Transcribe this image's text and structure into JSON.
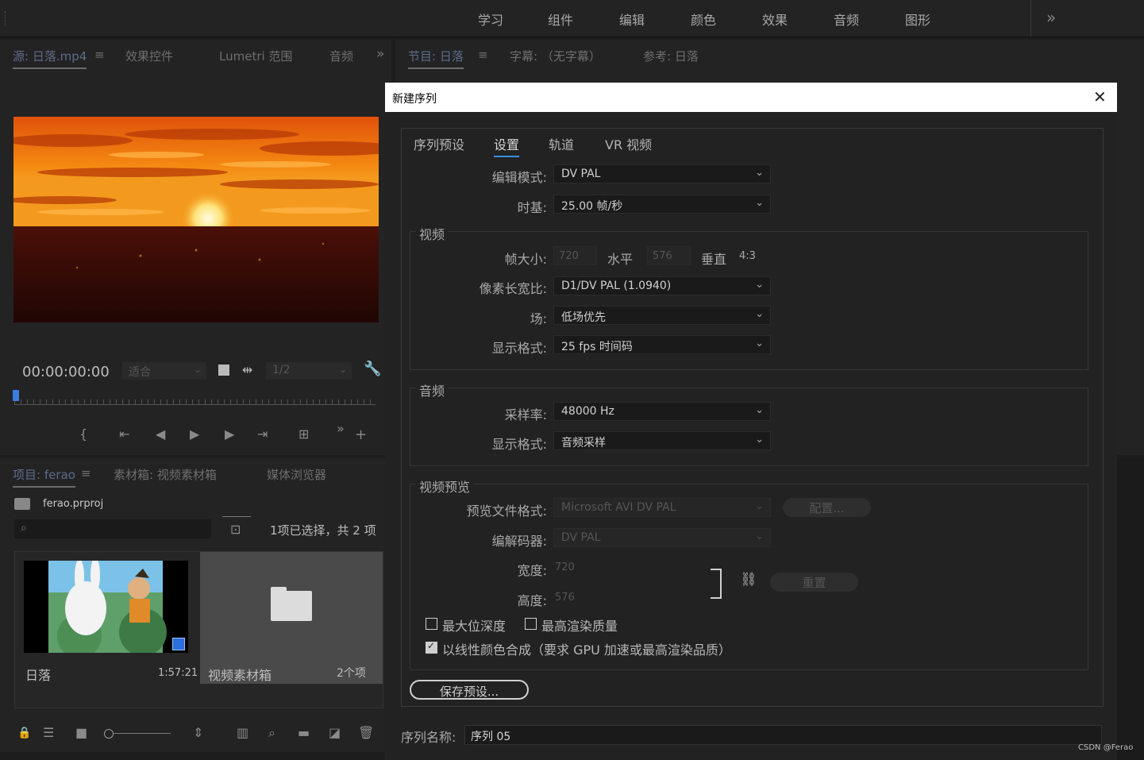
{
  "workspace_tabs": [
    "学习",
    "组件",
    "编辑",
    "颜色",
    "效果",
    "音频",
    "图形"
  ],
  "more_glyph": "»",
  "source_panel": {
    "tabs": [
      "源: 日落.mp4",
      "效果控件",
      "Lumetri 范围",
      "音频"
    ],
    "menu_glyph": "≡",
    "timecode": "00:00:00:00",
    "fit_label": "适合",
    "resolution": "1/2"
  },
  "program_panel": {
    "tabs": [
      "节目: 日落",
      "字幕: （无字幕）",
      "参考: 日落"
    ]
  },
  "project_panel": {
    "tabs": [
      "项目: ferao",
      "素材箱: 视频素材箱",
      "媒体浏览器"
    ],
    "file_name": "ferao.prproj",
    "selection_status": "1项已选择，共 2 项",
    "items": [
      {
        "name": "日落",
        "meta": "1:57:21"
      },
      {
        "name": "视频素材箱",
        "meta": "2个项"
      }
    ]
  },
  "dialog": {
    "title": "新建序列",
    "close_glyph": "✕",
    "tabs": [
      "序列预设",
      "设置",
      "轨道",
      "VR 视频"
    ],
    "active_tab": 1,
    "edit_mode": {
      "label": "编辑模式:",
      "value": "DV PAL"
    },
    "timebase": {
      "label": "时基:",
      "value": "25.00  帧/秒"
    },
    "video": {
      "title": "视频",
      "frame_size_label": "帧大小:",
      "width": "720",
      "horizontal_label": "水平",
      "height": "576",
      "vertical_label": "垂直",
      "aspect": "4:3",
      "pixel_aspect": {
        "label": "像素长宽比:",
        "value": "D1/DV PAL (1.0940)"
      },
      "fields": {
        "label": "场:",
        "value": "低场优先"
      },
      "display_format": {
        "label": "显示格式:",
        "value": "25 fps 时间码"
      }
    },
    "audio": {
      "title": "音频",
      "sample_rate": {
        "label": "采样率:",
        "value": "48000 Hz"
      },
      "display_format": {
        "label": "显示格式:",
        "value": "音频采样"
      }
    },
    "preview": {
      "title": "视频预览",
      "file_format": {
        "label": "预览文件格式:",
        "value": "Microsoft AVI DV PAL"
      },
      "configure_button": "配置...",
      "codec": {
        "label": "编解码器:",
        "value": "DV PAL"
      },
      "width": {
        "label": "宽度:",
        "value": "720"
      },
      "height": {
        "label": "高度:",
        "value": "576"
      },
      "reset_button": "重置",
      "max_bit_depth": {
        "label": "最大位深度",
        "checked": false
      },
      "max_render_quality": {
        "label": "最高渲染质量",
        "checked": false
      },
      "linear_color": {
        "label": "以线性颜色合成（要求 GPU 加速或最高渲染品质）",
        "checked": true
      }
    },
    "save_preset_button": "保存预设...",
    "sequence_name_label": "序列名称:",
    "sequence_name_value": "序列 05"
  },
  "watermark": "CSDN @Ferao"
}
